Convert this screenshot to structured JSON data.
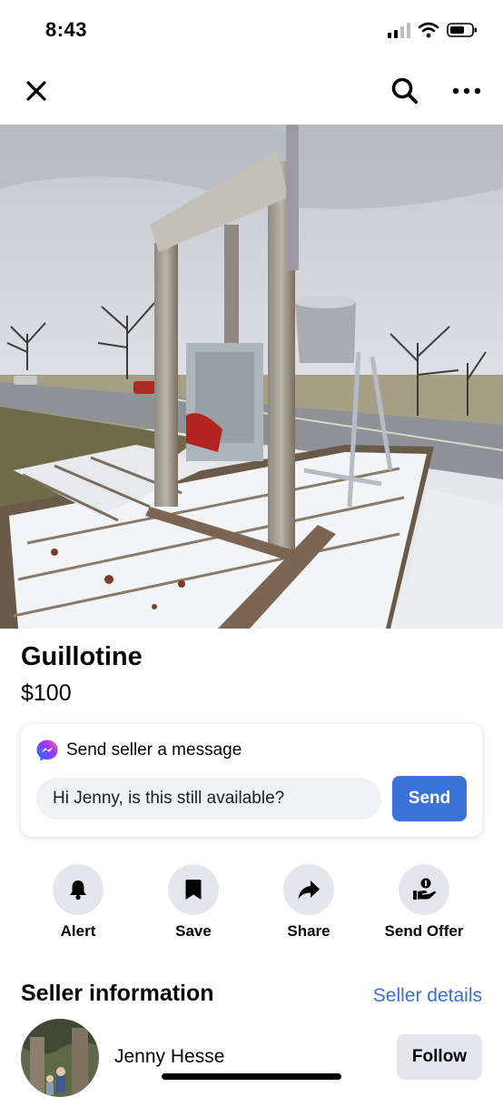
{
  "status_bar": {
    "time": "8:43",
    "icons": [
      "cellular-signal-icon",
      "wifi-icon",
      "battery-icon"
    ]
  },
  "nav": {
    "icons": [
      "close-icon",
      "search-icon",
      "more-icon"
    ]
  },
  "listing": {
    "title": "Guillotine",
    "price": "$100"
  },
  "message_card": {
    "header": "Send seller a message",
    "input_value": "Hi Jenny, is this still available?",
    "send_label": "Send",
    "accent_color": "#3b73d9"
  },
  "actions": [
    {
      "label": "Alert",
      "icon": "bell-icon"
    },
    {
      "label": "Save",
      "icon": "bookmark-icon"
    },
    {
      "label": "Share",
      "icon": "share-arrow-icon"
    },
    {
      "label": "Send Offer",
      "icon": "offer-hand-icon"
    }
  ],
  "seller": {
    "heading": "Seller information",
    "details_link": "Seller details",
    "name": "Jenny Hesse",
    "follow_label": "Follow"
  }
}
